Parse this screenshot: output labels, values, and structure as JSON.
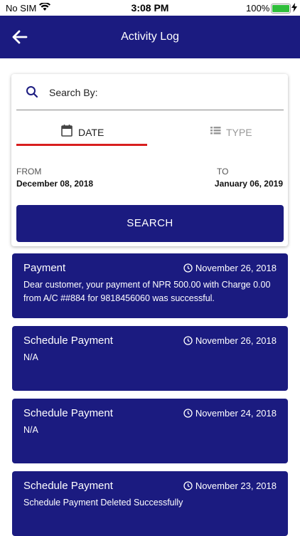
{
  "status": {
    "carrier": "No SIM",
    "time": "3:08 PM",
    "battery_pct": "100%"
  },
  "header": {
    "title": "Activity Log",
    "back_icon": "arrow-left-icon"
  },
  "search": {
    "label": "Search By:",
    "tabs": [
      {
        "label": "DATE",
        "icon": "calendar-icon",
        "active": true
      },
      {
        "label": "TYPE",
        "icon": "list-icon",
        "active": false
      }
    ],
    "from_label": "FROM",
    "from_date": "December 08, 2018",
    "to_label": "TO",
    "to_date": "January 06, 2019",
    "button": "SEARCH"
  },
  "activities": [
    {
      "title": "Payment",
      "date": "November 26, 2018",
      "message": "Dear customer, your payment of NPR 500.00 with Charge 0.00 from A/C ##884 for 9818456060 was successful."
    },
    {
      "title": "Schedule Payment",
      "date": "November 26, 2018",
      "message": "N/A"
    },
    {
      "title": "Schedule Payment",
      "date": "November 24, 2018",
      "message": "N/A"
    },
    {
      "title": "Schedule Payment",
      "date": "November 23, 2018",
      "message": "Schedule Payment Deleted Successfully"
    }
  ],
  "colors": {
    "primary": "#1b1b80",
    "tab_indicator": "#d81f1f",
    "battery": "#2fbe3b"
  }
}
